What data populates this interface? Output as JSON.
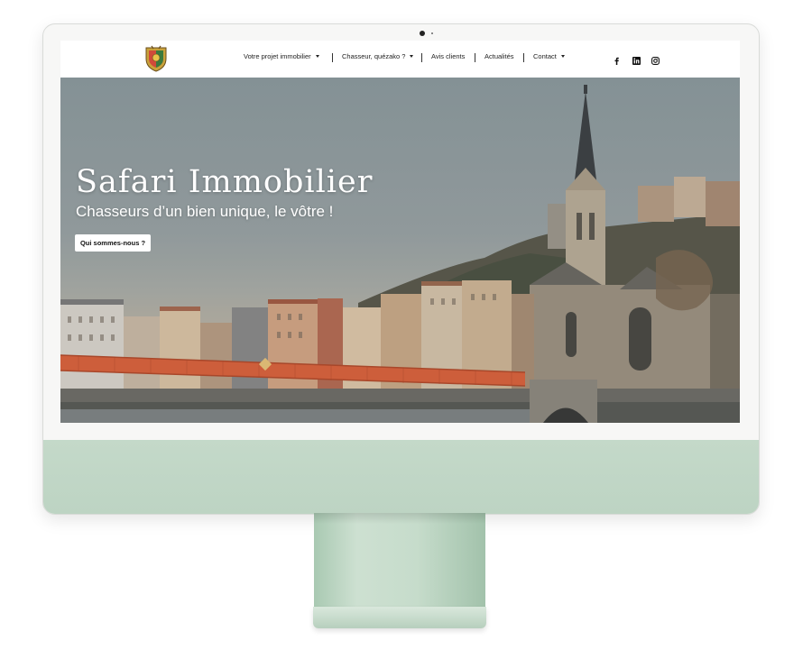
{
  "nav": {
    "items": [
      {
        "label": "Votre projet immobilier",
        "has_dropdown": true
      },
      {
        "label": "Chasseur, quézako ?",
        "has_dropdown": true
      },
      {
        "label": "Avis clients",
        "has_dropdown": false
      },
      {
        "label": "Actualités",
        "has_dropdown": false
      },
      {
        "label": "Contact",
        "has_dropdown": true
      }
    ],
    "social": [
      "facebook-icon",
      "linkedin-icon",
      "instagram-icon"
    ]
  },
  "hero": {
    "title": "Safari Immobilier",
    "subtitle": "Chasseurs d’un bien unique, le vôtre !",
    "cta_label": "Qui sommes-nous ?"
  },
  "colors": {
    "monitor_chin": "#c4d9c9",
    "bridge": "#d9643f",
    "text_dark": "#222222"
  }
}
